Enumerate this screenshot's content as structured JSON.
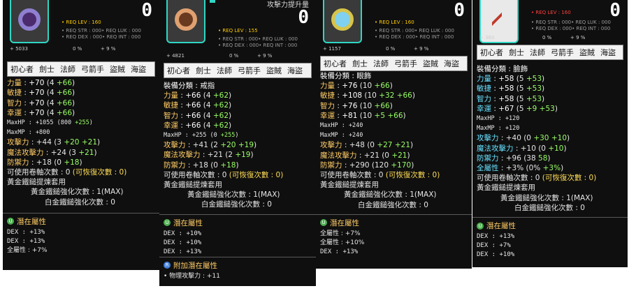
{
  "cards": [
    {
      "zero": "0",
      "req_lev": "• REQ LEV : 160",
      "req_str": "• REQ STR : 000• REQ LUK : 000",
      "req_dex": "• REQ DEX : 000• REQ INT : 000",
      "bottom_left": "+ 5033",
      "bottom_mid": "0 %",
      "bottom_right": "+ 9 %",
      "jobs": [
        "初心者",
        "劍士",
        "法師",
        "弓箭手",
        "盜賊",
        "海盜"
      ],
      "category": "裝備分類 : 戒指",
      "stats": [
        {
          "label": "力量",
          "sep": " : ",
          "value": "+70",
          "detail": "(4 ",
          "green": "+66",
          "end": ")"
        },
        {
          "label": "敏捷",
          "sep": " : ",
          "value": "+70",
          "detail": "(4 ",
          "green": "+66",
          "end": ")"
        },
        {
          "label": "智力",
          "sep": " : ",
          "value": "+70",
          "detail": "(4 ",
          "green": "+66",
          "end": ")"
        },
        {
          "label": "幸運",
          "sep": " : ",
          "value": "+70",
          "detail": "(4 ",
          "green": "+66",
          "end": ")"
        }
      ],
      "maxhp": "MaxHP : +1055 (800 ",
      "maxhp_g": "+255",
      "maxhp_end": ")",
      "maxmp": "MaxMP : +800",
      "atk_stats": [
        {
          "label": "攻擊力",
          "value": " : +44 (3 ",
          "a": "+20",
          "b": " +21",
          "end": ")"
        },
        {
          "label": "魔法攻擊力",
          "value": " : +24 (3 ",
          "a": "+21",
          "b": "",
          "end": ")"
        },
        {
          "label": "防禦力",
          "value": " : +18 (0 ",
          "a": "+18",
          "b": "",
          "end": ")"
        }
      ],
      "scroll": "可使用卷軸次數 : 0 ",
      "scroll_restore": "(可恢復次數 : 0)",
      "set_name": "黃金鐵鎚提煉套用",
      "enhance1": "黃金鐵鎚強化次數 : 1(MAX)",
      "enhance2": "白金鐵鎚強化次數 : 0",
      "potential_title": "潛在屬性",
      "potential_badge": "U",
      "potential": [
        "DEX : +13%",
        "DEX : +13%",
        "全屬性 : +7%"
      ]
    },
    {
      "zero": "0",
      "title": "攻擊力提升量",
      "req_lev": "• REQ LEV : 155",
      "req_str": "• REQ STR : 000• REQ LUK : 000",
      "req_dex": "• REQ DEX : 000• REQ INT : 000",
      "bottom_left": "+ 4821",
      "bottom_mid": "0 %",
      "bottom_right": "+ 9 %",
      "jobs": [
        "初心者",
        "劍士",
        "法師",
        "弓箭手",
        "盜賊",
        "海盜"
      ],
      "category": "裝備分類 : 戒指",
      "stats": [
        {
          "label": "力量",
          "sep": " : ",
          "value": "+66",
          "detail": "(4 ",
          "green": "+62",
          "end": ")"
        },
        {
          "label": "敏捷",
          "sep": " : ",
          "value": "+66",
          "detail": "(4 ",
          "green": "+62",
          "end": ")"
        },
        {
          "label": "智力",
          "sep": " : ",
          "value": "+66",
          "detail": "(4 ",
          "green": "+62",
          "end": ")"
        },
        {
          "label": "幸運",
          "sep": " : ",
          "value": "+66",
          "detail": "(4 ",
          "green": "+62",
          "end": ")"
        }
      ],
      "maxhp": "MaxHP : +255 (0 ",
      "maxhp_g": "+255",
      "maxhp_end": ")",
      "atk_stats": [
        {
          "label": "攻擊力",
          "value": " : +41 (2 ",
          "a": "+20",
          "b": " +19",
          "end": ")"
        },
        {
          "label": "魔法攻擊力",
          "value": " : +21 (2 ",
          "a": "+19",
          "b": "",
          "end": ")"
        },
        {
          "label": "防禦力",
          "value": " : +18 (0 ",
          "a": "+18",
          "b": "",
          "end": ")"
        }
      ],
      "scroll": "可使用卷軸次數 : 0 ",
      "scroll_restore": "(可恢復次數 : 0)",
      "set_name": "黃金鐵鎚提煉套用",
      "enhance1": "黃金鐵鎚強化次數 : 1(MAX)",
      "enhance2": "白金鐵鎚強化次數 : 0",
      "potential_title": "潛在屬性",
      "potential_badge": "U",
      "potential": [
        "DEX : +10%",
        "DEX : +10%",
        "DEX : +13%"
      ],
      "add_potential_title": "附加潛在屬性",
      "add_potential_badge": "R",
      "add_potential": [
        "• 物理攻擊力 : +11"
      ]
    },
    {
      "zero": "0",
      "req_lev": "• REQ LEV : 160",
      "req_str": "• REQ STR : 000• REQ LUK : 000",
      "req_dex": "• REQ DEX : 000• REQ INT : 000",
      "bottom_left": "+ 1157",
      "bottom_mid": "0 %",
      "bottom_right": "+ 9 %",
      "jobs": [
        "初心者",
        "劍士",
        "法師",
        "弓箭手",
        "盜賊",
        "海盜"
      ],
      "category": "裝備分類 : 眼飾",
      "stats": [
        {
          "label": "力量",
          "sep": " : ",
          "value": "+76",
          "detail": "(10 ",
          "green": "+66",
          "end": ")"
        },
        {
          "label": "敏捷",
          "sep": " : ",
          "value": "+108",
          "detail": "(10 ",
          "green": "+32 +66",
          "end": ")"
        },
        {
          "label": "智力",
          "sep": " : ",
          "value": "+76",
          "detail": "(10 ",
          "green": "+66",
          "end": ")"
        },
        {
          "label": "幸運",
          "sep": " : ",
          "value": "+81",
          "detail": "(10 ",
          "green": "+5 +66",
          "end": ")"
        }
      ],
      "maxhp": "MaxHP : +240",
      "maxmp": "MaxMP : +240",
      "atk_stats": [
        {
          "label": "攻擊力",
          "value": " : +48 (0 ",
          "a": "+27",
          "b": " +21",
          "end": ")"
        },
        {
          "label": "魔法攻擊力",
          "value": " : +21 (0 ",
          "a": "+21",
          "b": "",
          "end": ")"
        },
        {
          "label": "防禦力",
          "value": " : +290 (120 ",
          "a": "+170",
          "b": "",
          "end": ")"
        }
      ],
      "scroll": "可使用卷軸次數 : 0 ",
      "scroll_restore": "(可恢復次數 : 0)",
      "set_name": "黃金鐵鎚提煉套用",
      "enhance1": "黃金鐵鎚強化次數 : 1(MAX)",
      "enhance2": "白金鐵鎚強化次數 : 0",
      "potential_title": "潛在屬性",
      "potential_badge": "U",
      "potential": [
        "全屬性 : +7%",
        "全屬性 : +10%",
        "DEX : +13%"
      ]
    },
    {
      "zero": "0",
      "req_lev": "• REQ LEV : 160",
      "req_str": "• REQ STR : 000• REQ LUK : 000",
      "req_dex": "• REQ DEX : 000• REQ INT : 000",
      "bottom_left": "+ 360",
      "bottom_mid": "0 %",
      "bottom_right": "+ 9 %",
      "jobs": [
        "初心者",
        "劍士",
        "法師",
        "弓箭手",
        "盜賊",
        "海盜"
      ],
      "category": "裝備分類 : 臉飾",
      "stats": [
        {
          "label": "力量",
          "sep": " : ",
          "value": "+58",
          "detail": "(5 ",
          "green": "+53",
          "end": ")"
        },
        {
          "label": "敏捷",
          "sep": " : ",
          "value": "+58",
          "detail": "(5 ",
          "green": "+53",
          "end": ")"
        },
        {
          "label": "智力",
          "sep": " : ",
          "value": "+58",
          "detail": "(5 ",
          "green": "+53",
          "end": ")"
        },
        {
          "label": "幸運",
          "sep": " : ",
          "value": "+67",
          "detail": "(5 ",
          "green": "+9 +53",
          "end": ")"
        }
      ],
      "maxhp": "MaxHP : +120",
      "maxmp": "MaxMP : +120",
      "atk_stats": [
        {
          "label": "攻擊力",
          "value": " : +40 (0 ",
          "a": "+30",
          "b": " +10",
          "end": ")"
        },
        {
          "label": "魔法攻擊力",
          "value": " : +10 (0 ",
          "a": "+10",
          "b": "",
          "end": ")"
        },
        {
          "label": "防禦力",
          "value": " : +96 (38 ",
          "a": "58",
          "b": "",
          "end": ")"
        },
        {
          "label": "全屬性",
          "value": " : +3% (0% ",
          "a": "+3%",
          "b": "",
          "end": ")"
        }
      ],
      "scroll": "可使用卷軸次數 : 0 ",
      "scroll_restore": "(可恢復次數 : 0)",
      "set_name": "黃金鐵鎚提煉套用",
      "enhance1": "黃金鐵鎚強化次數 : 1(MAX)",
      "enhance2": "白金鐵鎚強化次數 : 0",
      "potential_title": "潛在屬性",
      "potential_badge": "U",
      "potential": [
        "DEX : +13%",
        "DEX : +7%",
        "DEX : +10%"
      ]
    }
  ]
}
